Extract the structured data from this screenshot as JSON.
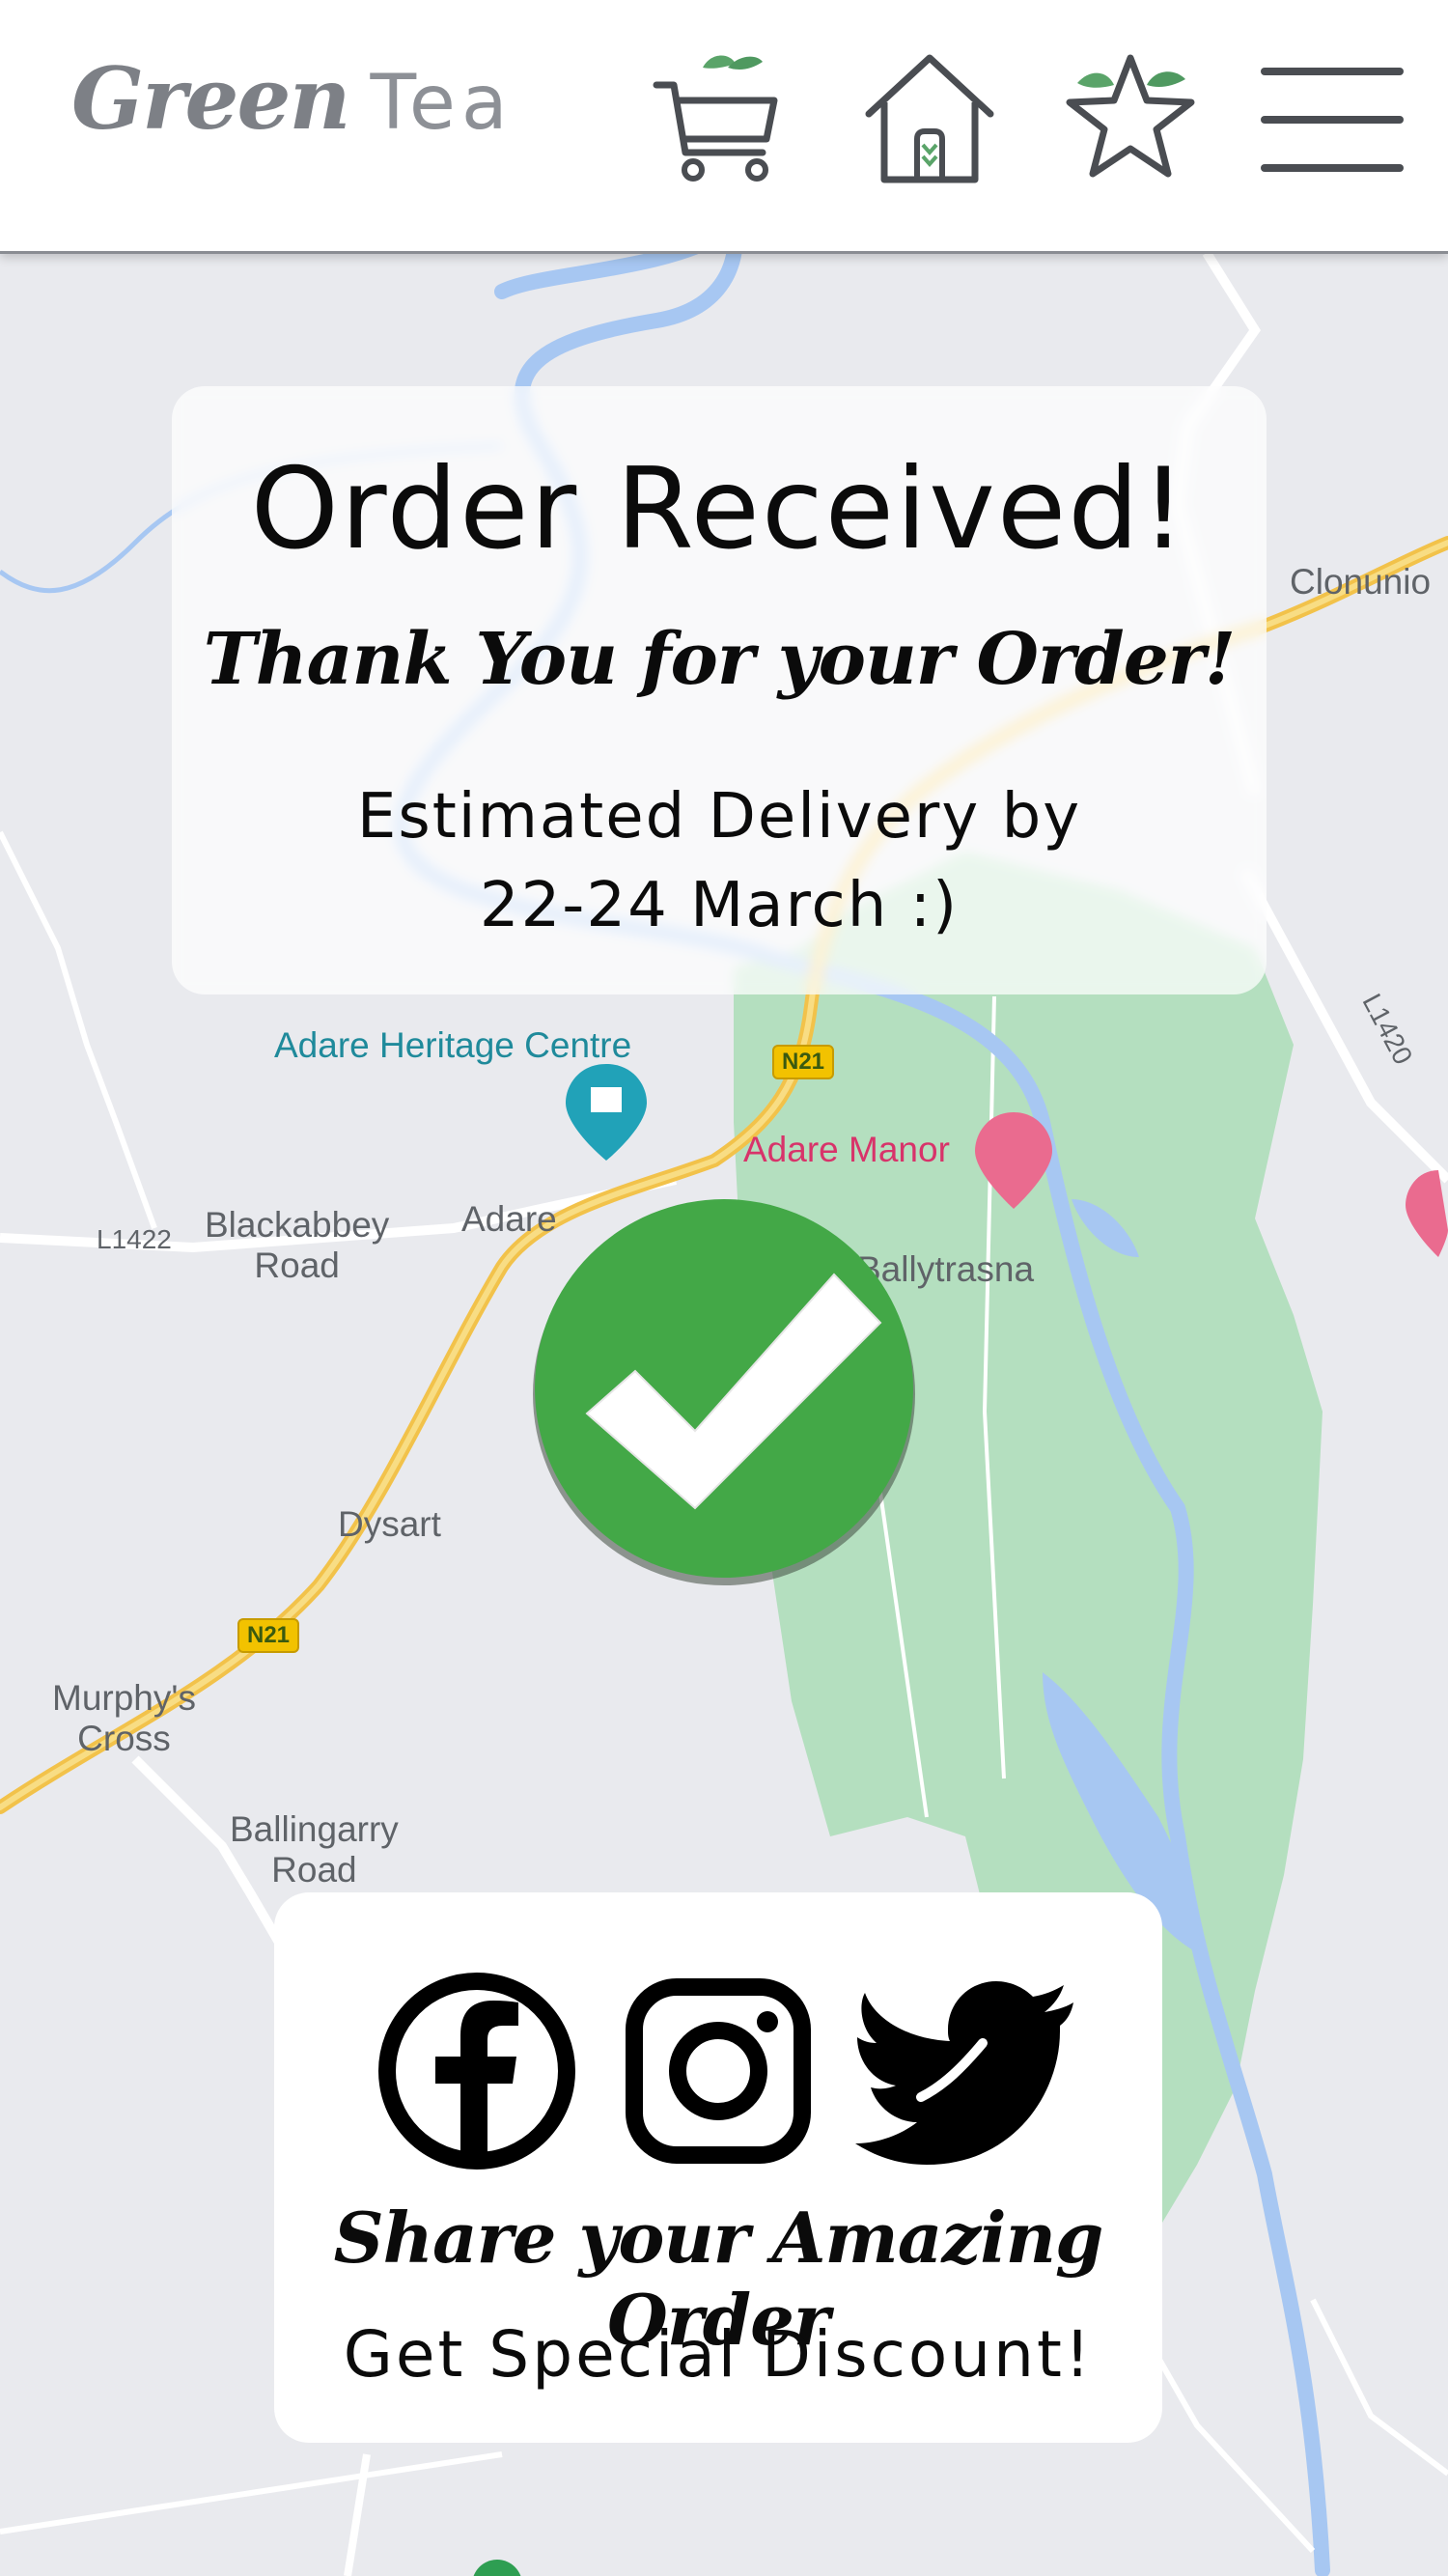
{
  "header": {
    "logo_primary": "Green",
    "logo_secondary": "Tea",
    "icons": [
      "cart-icon",
      "home-icon",
      "star-icon",
      "menu-icon"
    ],
    "accent_leaf": "#5aa469",
    "icon_stroke": "#4a4d52"
  },
  "map": {
    "labels": {
      "heritage": "Adare Heritage Centre",
      "manor": "Adare Manor",
      "adare": "Adare",
      "blackabbey": "Blackabbey\nRoad",
      "ballytrasna": "Ballytrasna",
      "dysart": "Dysart",
      "murphys": "Murphy's\nCross",
      "ballingarry": "Ballingarry\nRoad",
      "clonunion": "Clonunio"
    },
    "road_codes": {
      "n21_top": "N21",
      "n21_bottom": "N21",
      "l1422": "L1422",
      "l1420": "L1420"
    },
    "colors": {
      "land": "#e9eaee",
      "park": "#b4dfbf",
      "water": "#a7c7f2",
      "road_major": "#f2c24a",
      "road_minor": "#ffffff"
    }
  },
  "order": {
    "title": "Order Received!",
    "thanks": "Thank You for your Order!",
    "delivery_line1": "Estimated Delivery by",
    "delivery_line2": "22-24 March :)"
  },
  "status_icon": "check-icon",
  "status_color": "#43a847",
  "share": {
    "icons": [
      "facebook-icon",
      "instagram-icon",
      "twitter-icon"
    ],
    "line1": "Share your Amazing Order",
    "line2": "Get Special Discount!"
  }
}
